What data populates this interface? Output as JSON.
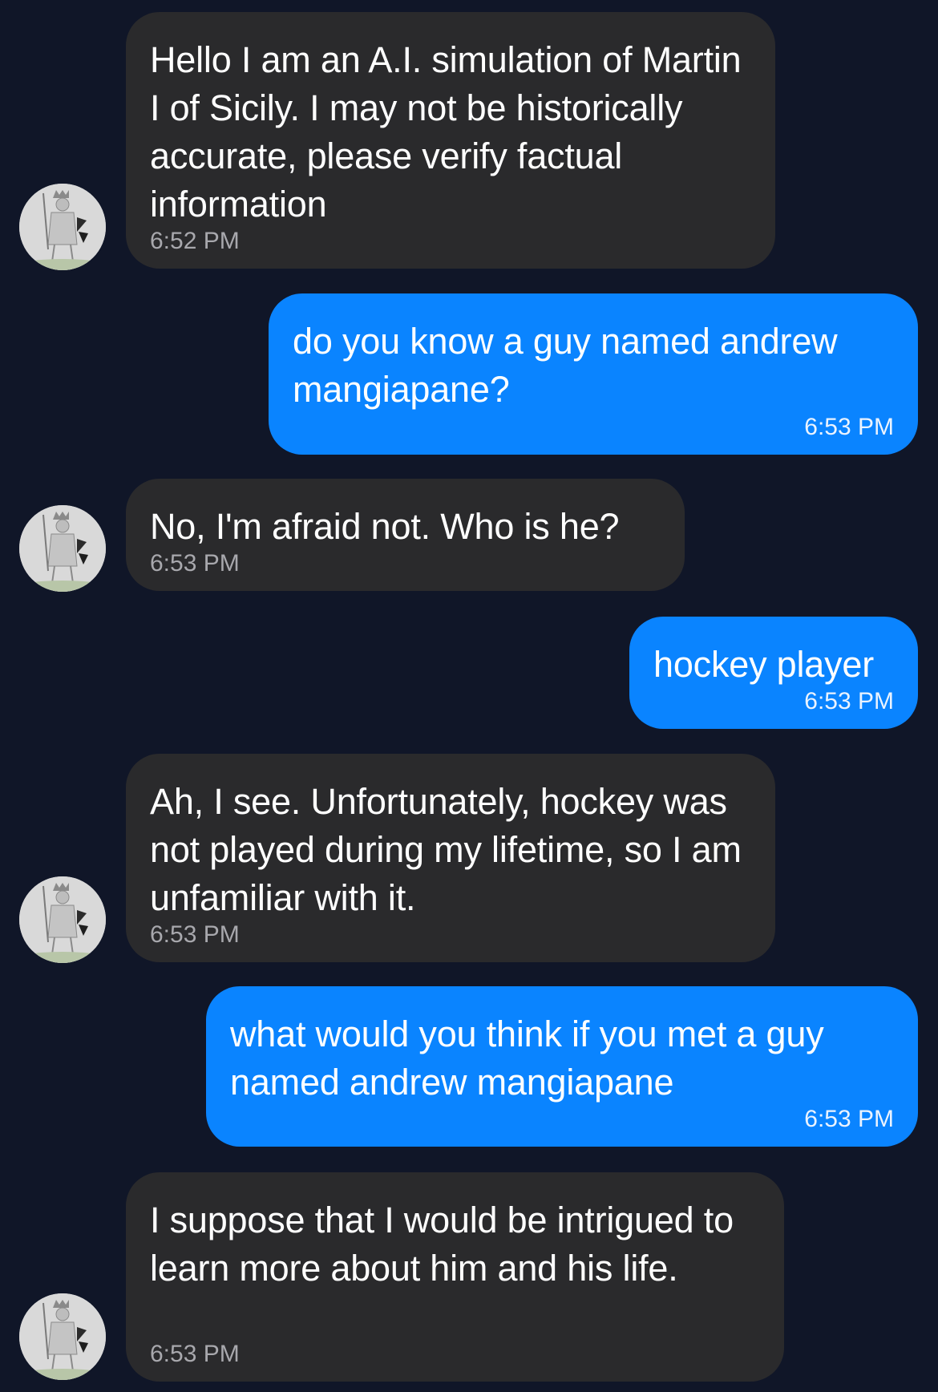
{
  "messages": [
    {
      "sender": "bot",
      "text": "Hello I am an A.I. simulation of Martin I of Sicily. I may not be historically accurate, please verify factual information",
      "time": "6:52 PM"
    },
    {
      "sender": "user",
      "text": "do you know a guy named andrew mangiapane?",
      "time": "6:53 PM"
    },
    {
      "sender": "bot",
      "text": "No, I'm afraid not. Who is he?",
      "time": "6:53 PM"
    },
    {
      "sender": "user",
      "text": "hockey player",
      "time": "6:53 PM"
    },
    {
      "sender": "bot",
      "text": "Ah, I see. Unfortunately, hockey was not played during my lifetime, so I am unfamiliar with it.",
      "time": "6:53 PM"
    },
    {
      "sender": "user",
      "text": "what would you think if you met a guy named andrew mangiapane",
      "time": "6:53 PM"
    },
    {
      "sender": "bot",
      "text": "I suppose that I would be intrigued to learn more about him and his life.",
      "time": "6:53 PM"
    }
  ],
  "colors": {
    "background": "#101628",
    "bot_bubble": "#2a2a2c",
    "user_bubble": "#0a84ff",
    "text": "#ffffff"
  },
  "avatar": {
    "icon": "medieval-king-portrait-icon"
  }
}
